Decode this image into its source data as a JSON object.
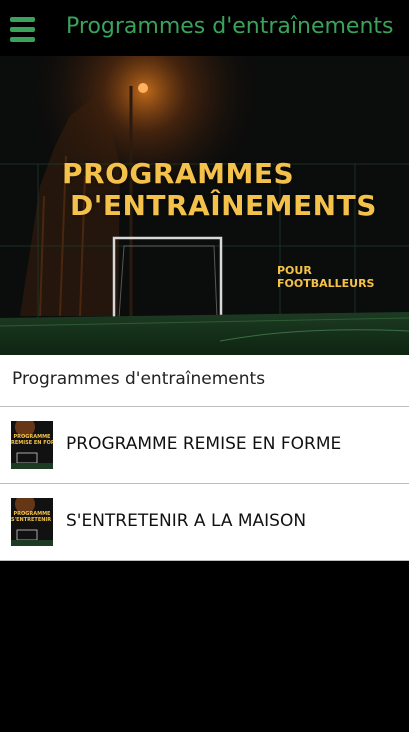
{
  "appbar": {
    "title": "Programmes d'entraînements",
    "menu_icon": "hamburger-icon"
  },
  "hero": {
    "title_line1": "PROGRAMMES",
    "title_line2": "D'ENTRAÎNEMENTS",
    "subtitle_line1": "POUR",
    "subtitle_line2": "FOOTBALLEURS"
  },
  "list": {
    "header": "Programmes d'entraînements",
    "items": [
      {
        "label": "PROGRAMME REMISE EN FORME",
        "thumb_line1": "PROGRAMME",
        "thumb_line2": "REMISE EN FORME"
      },
      {
        "label": "S'ENTRETENIR A LA MAISON",
        "thumb_line1": "PROGRAMME",
        "thumb_line2": "S'ENTRETENIR A LA MAISON"
      }
    ]
  },
  "colors": {
    "accent": "#3aa25a",
    "hero_text": "#f4c24a"
  }
}
